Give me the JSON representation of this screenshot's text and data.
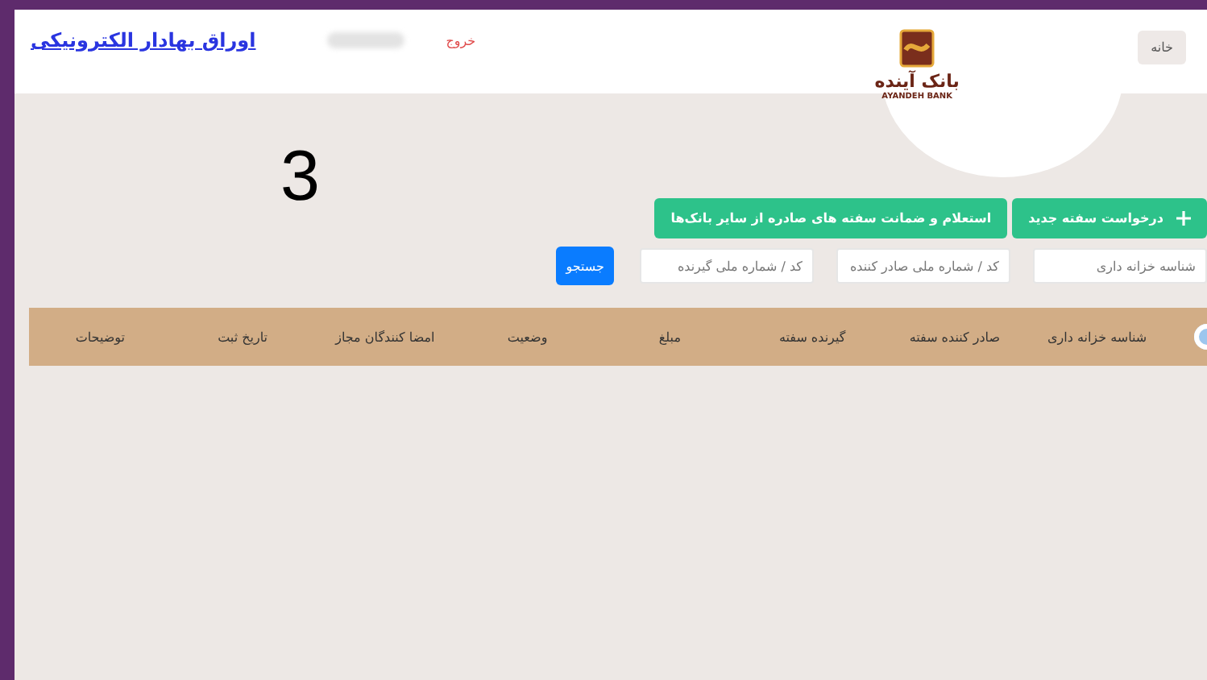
{
  "header": {
    "title": "اوراق بهادار الکترونیکی",
    "logout": "خروج",
    "logo_fa": "بانک آینده",
    "logo_en": "AYANDEH BANK",
    "home": "خانه"
  },
  "counter": "3",
  "actions": [
    {
      "label": "درخواست سفته جدید",
      "kind": "add"
    },
    {
      "label": "استعلام و ضمانت سفته های صادره از سایر بانک‌ها",
      "kind": "plain"
    }
  ],
  "search": {
    "fields": [
      {
        "placeholder": "شناسه خزانه داری"
      },
      {
        "placeholder": "کد / شماره ملی صادر کننده"
      },
      {
        "placeholder": "کد / شماره ملی گیرنده"
      }
    ],
    "button": "جستجو"
  },
  "table": {
    "columns": [
      "شناسه خزانه داری",
      "صادر کننده سفته",
      "گیرنده سفته",
      "مبلغ",
      "وضعیت",
      "امضا کنندگان مجاز",
      "تاریخ ثبت",
      "توضیحات"
    ]
  }
}
